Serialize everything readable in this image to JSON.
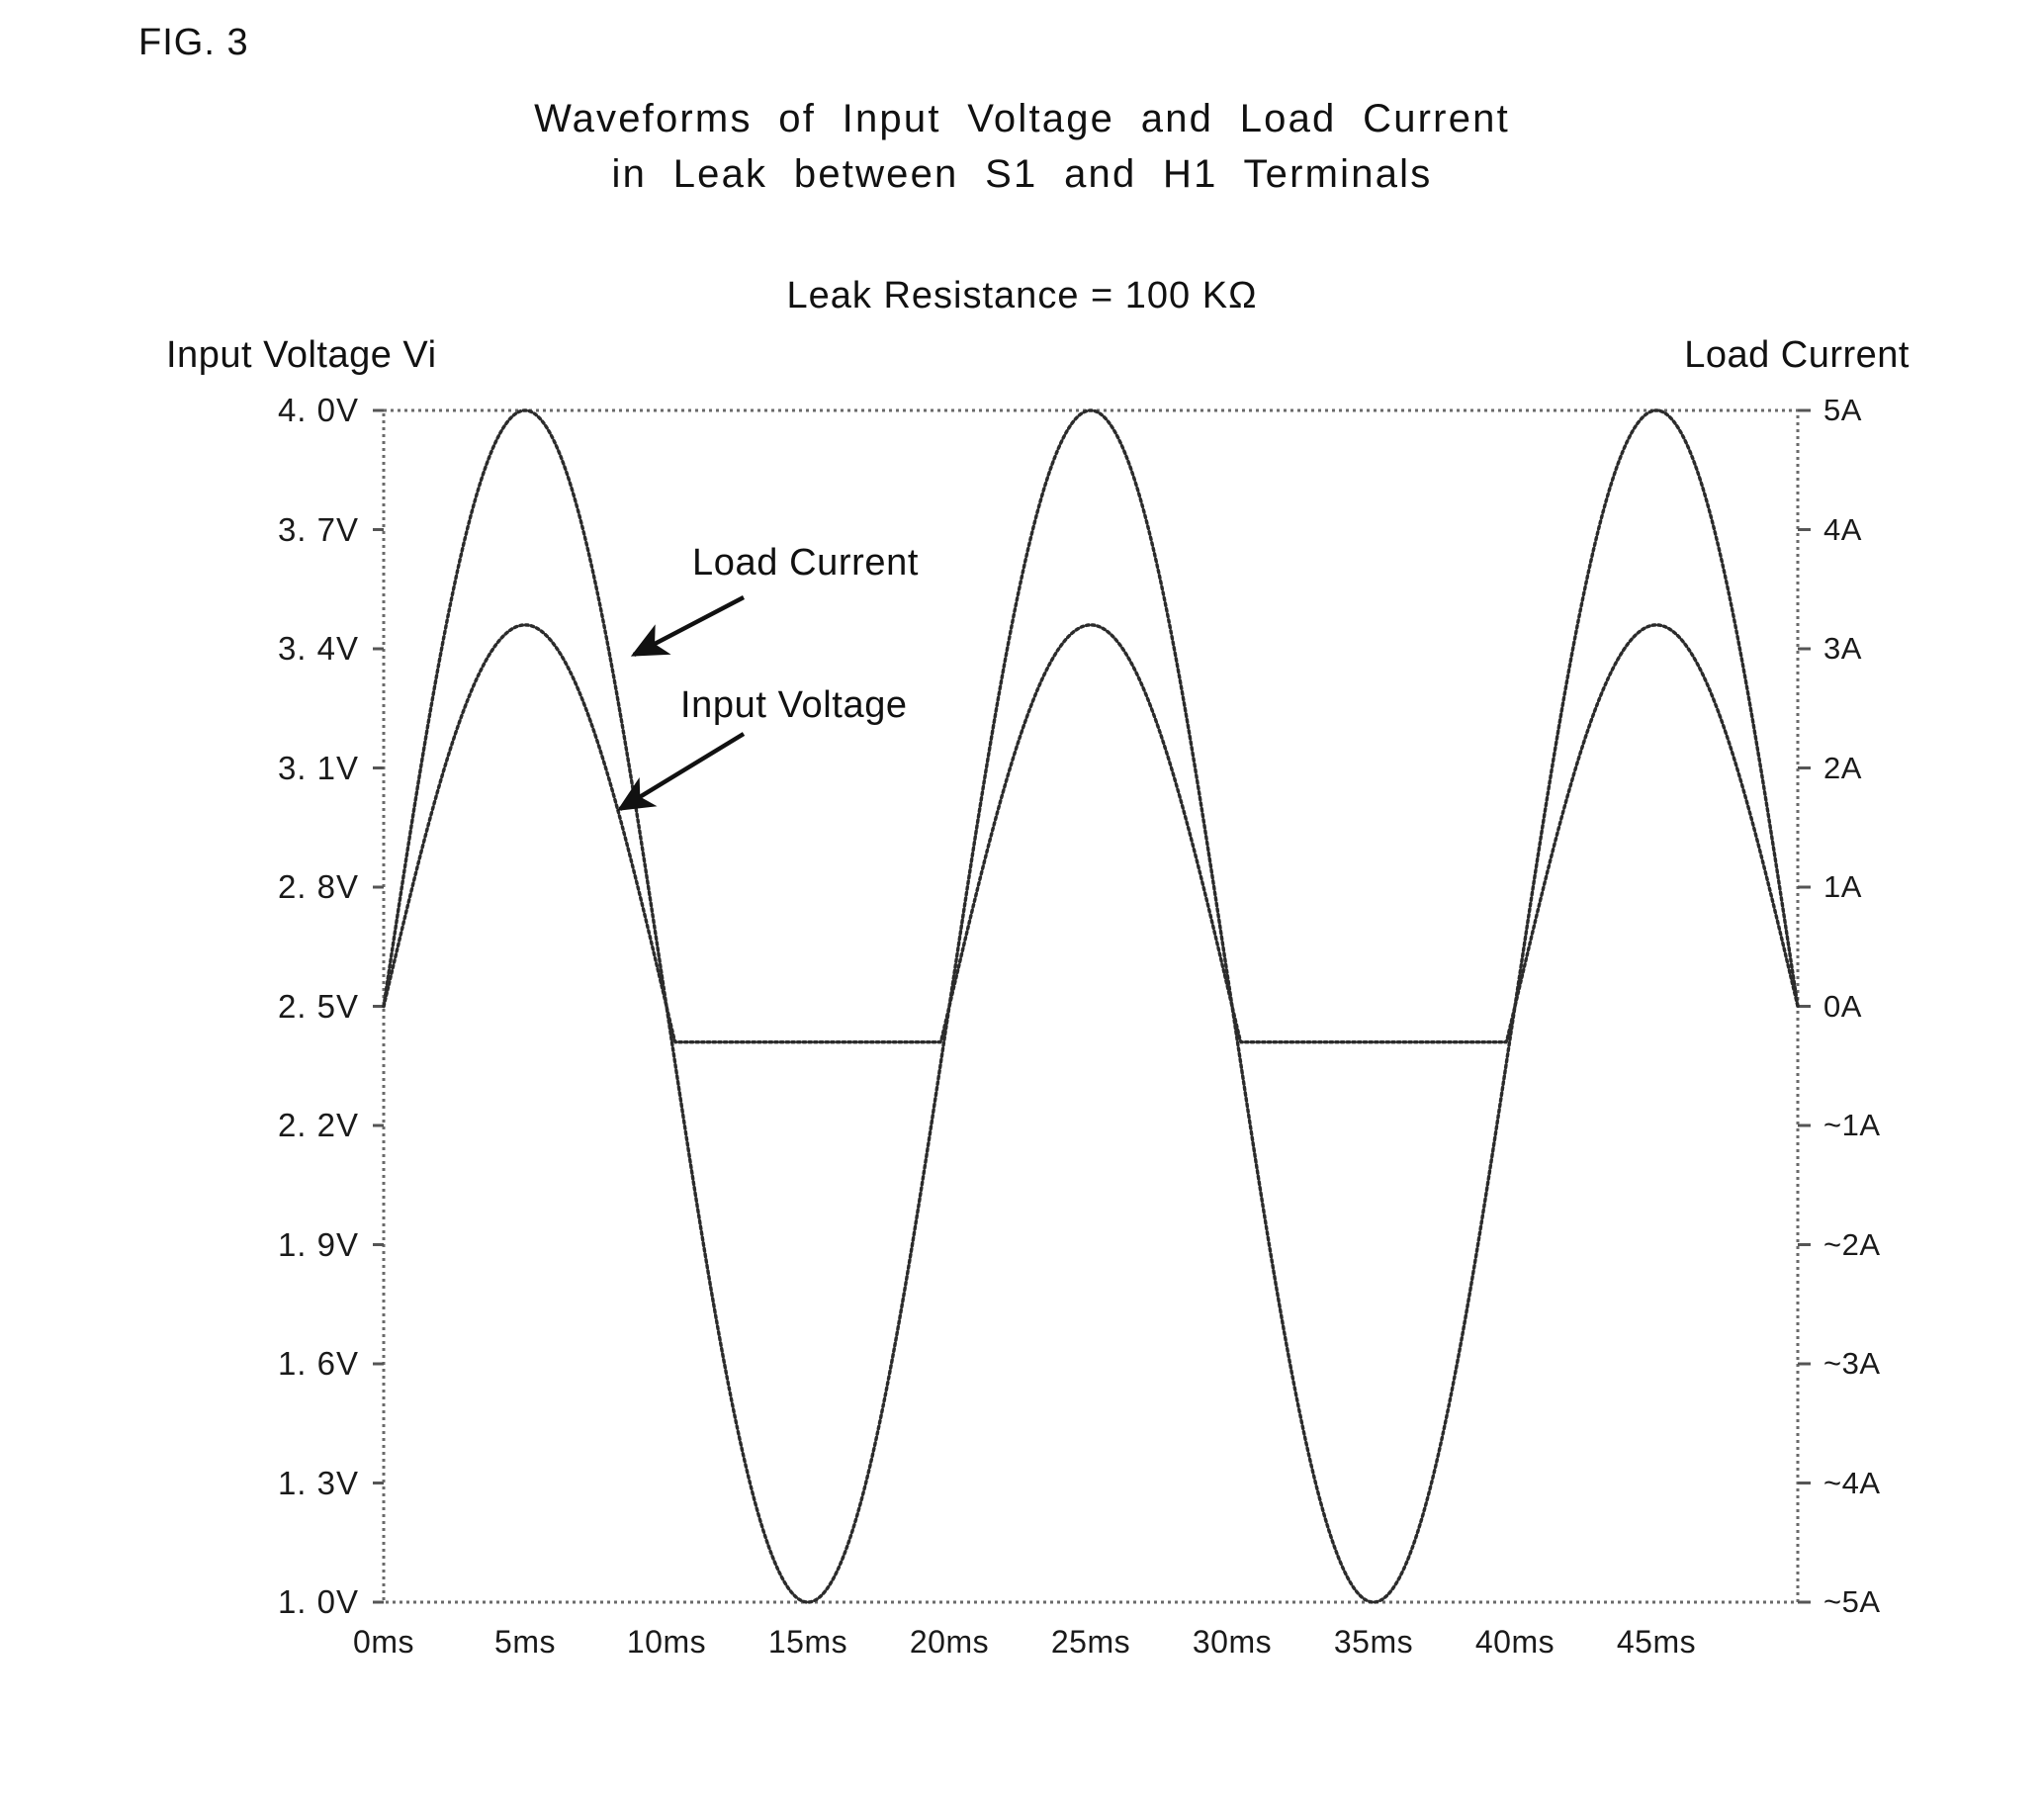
{
  "figure": {
    "label": "FIG. 3",
    "title_line1": "Waveforms  of  Input  Voltage  and  Load  Current",
    "title_line2": "in  Leak  between  S1  and  H1  Terminals",
    "subtitle": "Leak Resistance = 100 KΩ"
  },
  "axes": {
    "left_title": "Input Voltage Vi",
    "right_title": "Load Current"
  },
  "annotations": {
    "load_current": "Load Current",
    "input_voltage": "Input Voltage"
  },
  "chart_data": {
    "type": "line",
    "title": "Waveforms of Input Voltage and Load Current in Leak between S1 and H1 Terminals",
    "subtitle": "Leak Resistance = 100 KΩ",
    "xlabel": "",
    "ylabel": "Input Voltage Vi",
    "y2label": "Load Current",
    "grid": false,
    "legend": "none",
    "x_unit": "ms",
    "xlim": [
      0,
      50
    ],
    "xticks": [
      0,
      5,
      10,
      15,
      20,
      25,
      30,
      35,
      40,
      45
    ],
    "xticklabels": [
      "0ms",
      "5ms",
      "10ms",
      "15ms",
      "20ms",
      "25ms",
      "30ms",
      "35ms",
      "40ms",
      "45ms"
    ],
    "ylim": [
      1.0,
      4.0
    ],
    "yticks": [
      1.0,
      1.3,
      1.6,
      1.9,
      2.2,
      2.5,
      2.8,
      3.1,
      3.4,
      3.7,
      4.0
    ],
    "yticklabels": [
      "1. 0V",
      "1. 3V",
      "1. 6V",
      "1. 9V",
      "2. 2V",
      "2. 5V",
      "2. 8V",
      "3. 1V",
      "3. 4V",
      "3. 7V",
      "4. 0V"
    ],
    "y2lim": [
      -5,
      5
    ],
    "y2ticks": [
      -5,
      -4,
      -3,
      -2,
      -1,
      0,
      1,
      2,
      3,
      4,
      5
    ],
    "y2ticklabels": [
      "~5A",
      "~4A",
      "~3A",
      "~2A",
      "~1A",
      "0A",
      "1A",
      "2A",
      "3A",
      "4A",
      "5A"
    ],
    "series": [
      {
        "name": "Input Voltage",
        "axis": "left",
        "unit": "V",
        "description": "Full sinusoid, 20 ms period, offset 2.5 V, amplitude 1.5 V peak, peaks 4.0 V at 5/25/45 ms, troughs 1.0 V at 15/35 ms",
        "period_ms": 20,
        "offset_V": 2.5,
        "amplitude_V": 1.5,
        "peak_V": 4.0,
        "trough_V": 1.0,
        "peak_times_ms": [
          5,
          25,
          45
        ],
        "trough_times_ms": [
          15,
          35
        ]
      },
      {
        "name": "Load Current",
        "axis": "right",
        "unit": "A",
        "description": "Half-wave rectified sinusoid clipped flat at -0.3 A during negative half cycles; positive peaks 3.2 A at 5/25/45 ms",
        "period_ms": 20,
        "peak_A": 3.2,
        "clip_level_A": -0.3,
        "peak_times_ms": [
          5,
          25,
          45
        ],
        "clip_intervals_ms": [
          [
            11.3,
            19.0
          ],
          [
            31.3,
            39.0
          ]
        ]
      }
    ],
    "sampled_points": {
      "t_ms": [
        0,
        1,
        2,
        3,
        4,
        5,
        6,
        7,
        8,
        9,
        10,
        11,
        12,
        13,
        14,
        15,
        16,
        17,
        18,
        19,
        20,
        21,
        22,
        23,
        24,
        25,
        26,
        27,
        28,
        29,
        30,
        31,
        32,
        33,
        34,
        35,
        36,
        37,
        38,
        39,
        40,
        41,
        42,
        43,
        44,
        45,
        46,
        47,
        48,
        49,
        50
      ],
      "input_voltage_V": [
        2.5,
        2.96,
        3.38,
        3.71,
        3.93,
        4.0,
        3.93,
        3.71,
        3.38,
        2.96,
        2.5,
        2.04,
        1.62,
        1.29,
        1.07,
        1.0,
        1.07,
        1.29,
        1.62,
        2.04,
        2.5,
        2.96,
        3.38,
        3.71,
        3.93,
        4.0,
        3.93,
        3.71,
        3.38,
        2.96,
        2.5,
        2.04,
        1.62,
        1.29,
        1.07,
        1.0,
        1.07,
        1.29,
        1.62,
        2.04,
        2.5,
        2.96,
        3.38,
        3.71,
        3.93,
        4.0,
        3.93,
        3.71,
        3.38,
        2.96,
        2.5
      ],
      "load_current_A": [
        0.0,
        0.99,
        1.88,
        2.59,
        3.04,
        3.2,
        3.04,
        2.59,
        1.88,
        0.99,
        0.0,
        -0.3,
        -0.3,
        -0.3,
        -0.3,
        -0.3,
        -0.3,
        -0.3,
        -0.3,
        -0.3,
        0.0,
        0.99,
        1.88,
        2.59,
        3.04,
        3.2,
        3.04,
        2.59,
        1.88,
        0.99,
        0.0,
        -0.3,
        -0.3,
        -0.3,
        -0.3,
        -0.3,
        -0.3,
        -0.3,
        -0.3,
        -0.3,
        0.0,
        0.99,
        1.88,
        2.59,
        3.04,
        3.2,
        3.04,
        2.59,
        1.88,
        0.99,
        0.0
      ]
    }
  },
  "colors": {
    "ink": "#111111",
    "trace": "#2b2b2b",
    "frame": "#555555"
  }
}
